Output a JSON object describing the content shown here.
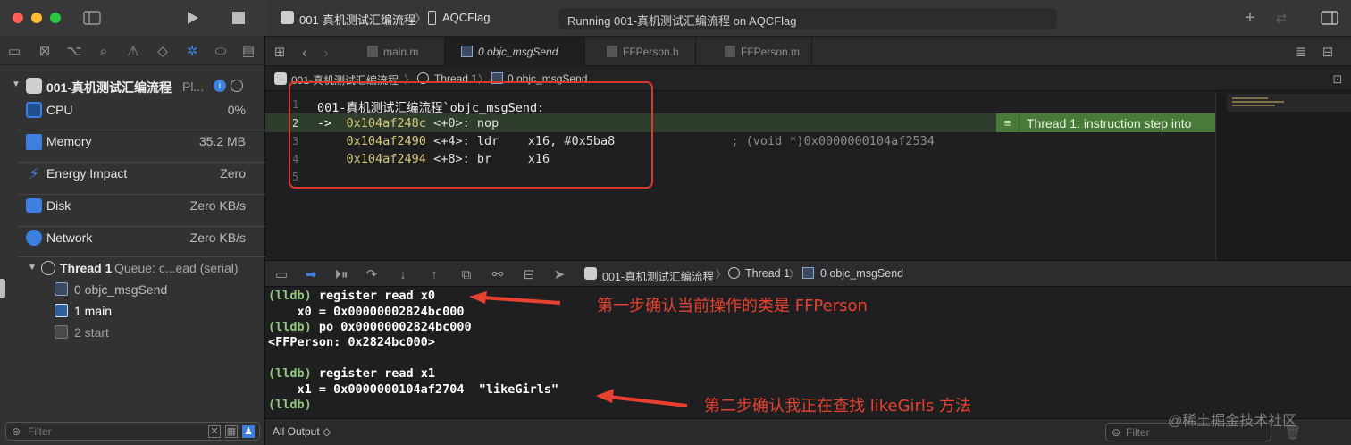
{
  "left": {
    "process": {
      "name": "001-真机测试汇编流程",
      "suffix": "Pl..."
    },
    "gauges": [
      {
        "label": "CPU",
        "value": "0%"
      },
      {
        "label": "Memory",
        "value": "35.2 MB"
      },
      {
        "label": "Energy Impact",
        "value": "Zero"
      },
      {
        "label": "Disk",
        "value": "Zero KB/s"
      },
      {
        "label": "Network",
        "value": "Zero KB/s"
      }
    ],
    "thread": {
      "title": "Thread 1",
      "queue": "Queue: c...ead (serial)"
    },
    "frames": [
      "0 objc_msgSend",
      "1 main",
      "2 start"
    ],
    "filter_placeholder": "Filter"
  },
  "titlebar": {
    "scheme": "001-真机测试汇编流程",
    "device": "AQCFlag",
    "status": "Running 001-真机测试汇编流程 on AQCFlag"
  },
  "tabs": [
    "main.m",
    "0 objc_msgSend",
    "FFPerson.h",
    "FFPerson.m"
  ],
  "jumpbar": {
    "project": "001-真机测试汇编流程",
    "thread": "Thread 1",
    "frame": "0 objc_msgSend"
  },
  "editor": {
    "lines": [
      {
        "n": "1",
        "text": "001-真机测试汇编流程`objc_msgSend:"
      },
      {
        "n": "2",
        "arrow": "->",
        "addr": "0x104af248c",
        "off": "<+0>:",
        "op": "nop",
        "args": "",
        "comment": ""
      },
      {
        "n": "3",
        "arrow": "",
        "addr": "0x104af2490",
        "off": "<+4>:",
        "op": "ldr",
        "args": "x16, #0x5ba8",
        "comment": "; (void *)0x0000000104af2534"
      },
      {
        "n": "4",
        "arrow": "",
        "addr": "0x104af2494",
        "off": "<+8>:",
        "op": "br",
        "args": "x16",
        "comment": ""
      },
      {
        "n": "5",
        "text": ""
      }
    ],
    "annotation": "Thread 1: instruction step into"
  },
  "debugbar": {
    "project": "001-真机测试汇编流程",
    "thread": "Thread 1",
    "frame": "0 objc_msgSend"
  },
  "console": {
    "lines": [
      {
        "prompt": "(lldb)",
        "cmd": "register read x0"
      },
      {
        "prompt": "",
        "cmd": "    x0 = 0x00000002824bc000"
      },
      {
        "prompt": "(lldb)",
        "cmd": "po 0x00000002824bc000"
      },
      {
        "prompt": "",
        "cmd": "<FFPerson: 0x2824bc000>"
      },
      {
        "prompt": "",
        "cmd": ""
      },
      {
        "prompt": "(lldb)",
        "cmd": "register read x1"
      },
      {
        "prompt": "",
        "cmd": "    x1 = 0x0000000104af2704  \"likeGirls\""
      },
      {
        "prompt": "(lldb)",
        "cmd": ""
      }
    ],
    "note1": "第一步确认当前操作的类是 FFPerson",
    "note2": "第二步确认我正在查找 likeGirls 方法"
  },
  "status": {
    "output": "All Output ◇",
    "filter_placeholder": "Filter",
    "watermark": "@稀土掘金技术社区"
  },
  "colors": {
    "accent": "#3d7fe0",
    "annotation_red": "#e8412f",
    "lldb_green": "#8fc97a",
    "step_green": "#4a7a3a"
  }
}
